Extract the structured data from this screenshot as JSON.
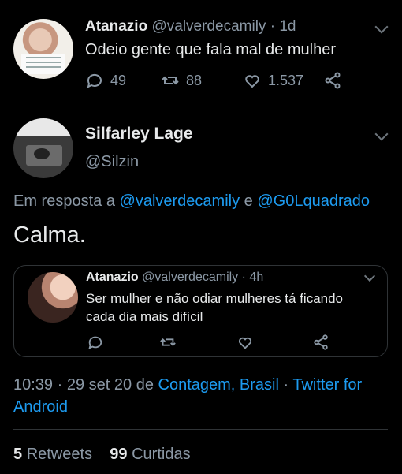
{
  "parent_tweet": {
    "author_name": "Atanazio",
    "author_handle": "@valverdecamily",
    "separator": "·",
    "age": "1d",
    "text": "Odeio gente que fala mal de mulher",
    "replies_count": "49",
    "retweets_count": "88",
    "likes_count": "1.537"
  },
  "main_tweet": {
    "author_name": "Silfarley Lage",
    "author_handle": "@Silzin",
    "reply_prefix": "Em resposta a",
    "reply_to_1": "@valverdecamily",
    "reply_conjunction": "e",
    "reply_to_2": "@G0Lquadrado",
    "text": "Calma.",
    "time": "10:39",
    "dot1": "·",
    "date": "29 set 20",
    "location_prefix": "de",
    "location": "Contagem, Brasil",
    "dot2": "·",
    "source": "Twitter for Android",
    "retweets_count": "5",
    "retweets_label": "Retweets",
    "likes_count": "99",
    "likes_label": "Curtidas"
  },
  "quoted_tweet": {
    "author_name": "Atanazio",
    "author_handle": "@valverdecamily",
    "separator": "·",
    "age": "4h",
    "text": "Ser mulher e não odiar mulheres tá ficando cada dia mais difícil"
  },
  "icons": [
    "reply-icon",
    "retweet-icon",
    "like-icon",
    "share-icon",
    "chevron-down-icon"
  ],
  "colors": {
    "background": "#000000",
    "link": "#1d9bf0",
    "secondary": "#8b98a5",
    "primary_text": "#e7e9ea"
  }
}
